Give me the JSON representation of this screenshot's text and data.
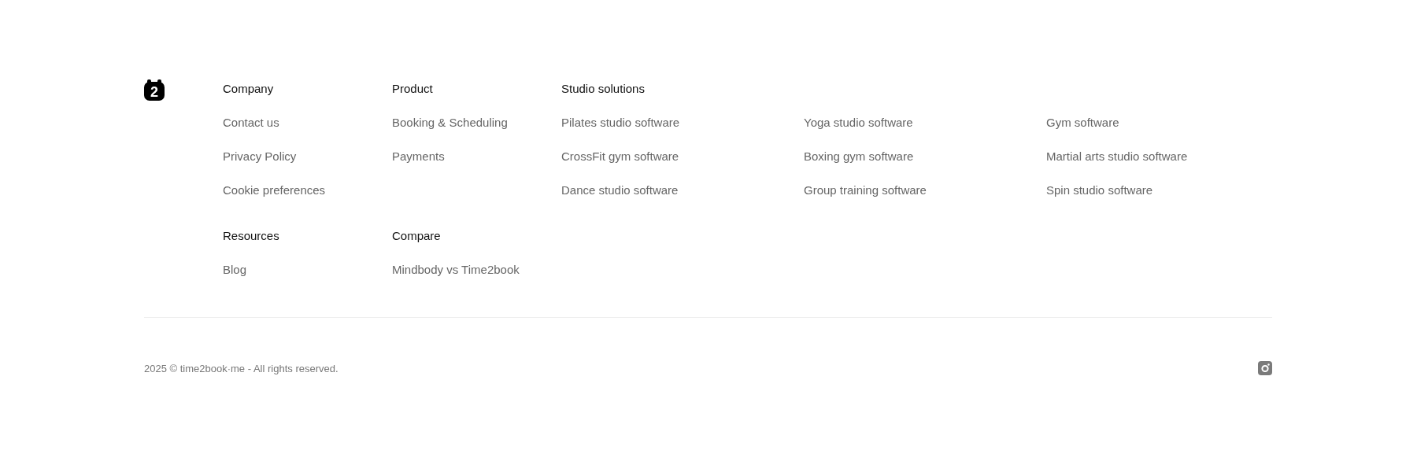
{
  "logo": {
    "label": "2"
  },
  "sections": [
    {
      "heading": "Company",
      "links": [
        "Contact us",
        "Privacy Policy",
        "Cookie preferences"
      ]
    },
    {
      "heading": "Product",
      "links": [
        "Booking & Scheduling",
        "Payments"
      ]
    },
    {
      "heading": "Studio solutions",
      "links": [
        "Pilates studio software",
        "CrossFit gym software",
        "Dance studio software",
        "Yoga studio software",
        "Boxing gym software",
        "Group training software",
        "Gym software",
        "Martial arts studio software",
        "Spin studio software"
      ]
    },
    {
      "heading": "Resources",
      "links": [
        "Blog"
      ]
    },
    {
      "heading": "Compare",
      "links": [
        "Mindbody vs Time2book"
      ]
    }
  ],
  "copyright": "2025 © time2book·me - All rights reserved."
}
